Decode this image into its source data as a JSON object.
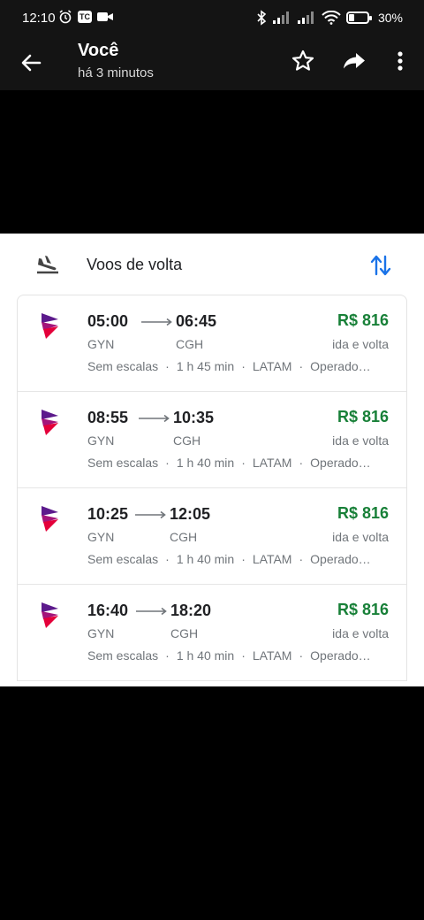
{
  "status_bar": {
    "time": "12:10",
    "badge": "TC",
    "battery": "30%"
  },
  "app_bar": {
    "title": "Você",
    "subtitle": "há 3 minutos"
  },
  "section": {
    "label": "Voos de volta"
  },
  "flights": [
    {
      "dep_time": "05:00",
      "arr_time": "06:45",
      "dep_code": "GYN",
      "arr_code": "CGH",
      "stops": "Sem escalas",
      "duration": "1 h 45 min",
      "airline": "LATAM",
      "operator": "Operado…",
      "price": "R$ 816",
      "trip": "ida e volta"
    },
    {
      "dep_time": "08:55",
      "arr_time": "10:35",
      "dep_code": "GYN",
      "arr_code": "CGH",
      "stops": "Sem escalas",
      "duration": "1 h 40 min",
      "airline": "LATAM",
      "operator": "Operado…",
      "price": "R$ 816",
      "trip": "ida e volta"
    },
    {
      "dep_time": "10:25",
      "arr_time": "12:05",
      "dep_code": "GYN",
      "arr_code": "CGH",
      "stops": "Sem escalas",
      "duration": "1 h 40 min",
      "airline": "LATAM",
      "operator": "Operado…",
      "price": "R$ 816",
      "trip": "ida e volta"
    },
    {
      "dep_time": "16:40",
      "arr_time": "18:20",
      "dep_code": "GYN",
      "arr_code": "CGH",
      "stops": "Sem escalas",
      "duration": "1 h 40 min",
      "airline": "LATAM",
      "operator": "Operado…",
      "price": "R$ 816",
      "trip": "ida e volta"
    }
  ],
  "colors": {
    "price": "#188038",
    "accent_swap": "#1a73e8",
    "latam_purple": "#5c1a8c",
    "latam_red": "#e4003a"
  },
  "icons": {
    "back": "arrow-back-icon",
    "star": "star-outline-icon",
    "share": "share-icon",
    "more": "more-vert-icon",
    "landing": "flight-land-icon",
    "swap": "swap-vertical-icon"
  }
}
